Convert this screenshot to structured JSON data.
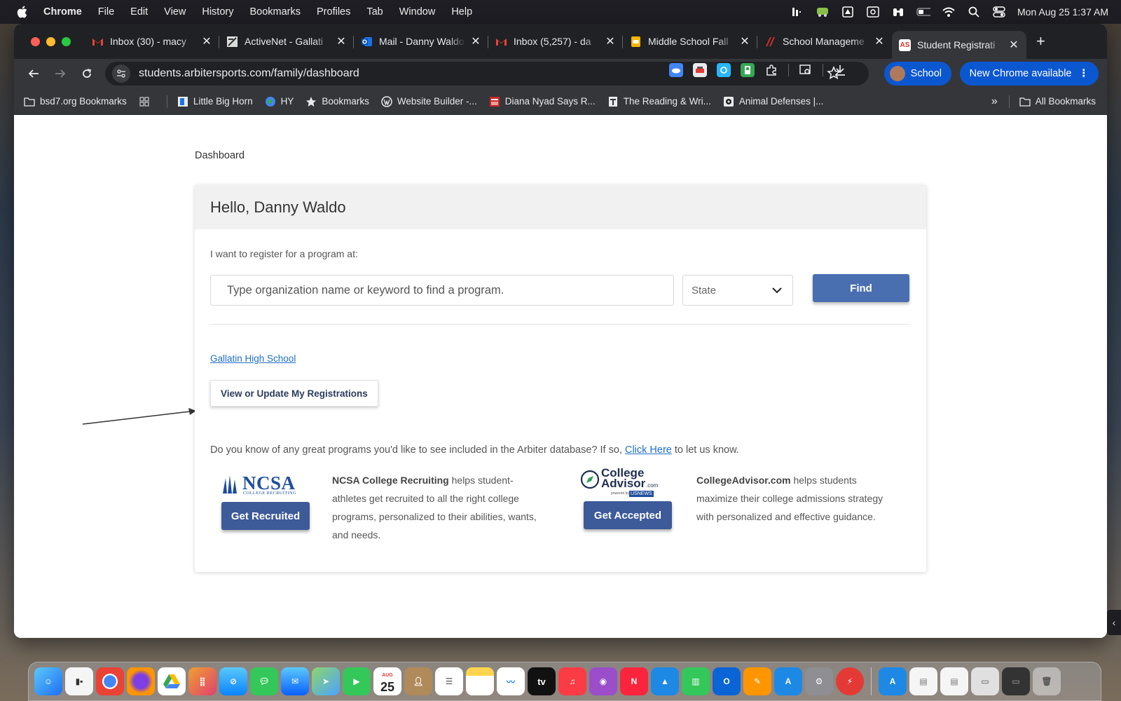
{
  "menubar": {
    "app": "Chrome",
    "items": [
      "File",
      "Edit",
      "View",
      "History",
      "Bookmarks",
      "Profiles",
      "Tab",
      "Window",
      "Help"
    ],
    "clock": "Mon Aug 25  1:37 AM"
  },
  "tabs": [
    {
      "label": "Inbox (30) - macy",
      "favicon": "gmail-icon",
      "color": "#ea4335"
    },
    {
      "label": "ActiveNet - Gallati",
      "favicon": "activenet-icon",
      "color": "#cfcfcf"
    },
    {
      "label": "Mail - Danny Waldo",
      "favicon": "outlook-icon",
      "color": "#1a73e8"
    },
    {
      "label": "Inbox (5,257) - da",
      "favicon": "gmail-icon",
      "color": "#ea4335"
    },
    {
      "label": "Middle School Fall",
      "favicon": "slides-icon",
      "color": "#f4b400"
    },
    {
      "label": "School Manageme",
      "favicon": "arbiter-icon",
      "color": "#d93025"
    },
    {
      "label": "Student Registrati",
      "favicon": "arbiter-as-icon",
      "color": "#ffffff",
      "active": true,
      "fav_text": "AS"
    }
  ],
  "toolbar": {
    "url": "students.arbitersports.com/family/dashboard",
    "profile_label": "School",
    "update_label": "New Chrome available"
  },
  "bookmarks": {
    "items": [
      {
        "label": "bsd7.org Bookmarks",
        "icon": "folder-managed-icon"
      },
      {
        "label": "Little Big Horn",
        "icon": "bookmark-site-icon"
      },
      {
        "label": "HY",
        "icon": "globe-icon"
      },
      {
        "label": "Bookmarks",
        "icon": "star-icon"
      },
      {
        "label": "Website Builder -...",
        "icon": "wordpress-icon"
      },
      {
        "label": "Diana Nyad Says R...",
        "icon": "news-icon"
      },
      {
        "label": "The Reading & Wri...",
        "icon": "page-icon"
      },
      {
        "label": "Animal Defenses |...",
        "icon": "site-icon"
      }
    ],
    "overflow": "»",
    "all_label": "All Bookmarks"
  },
  "page": {
    "breadcrumb": "Dashboard",
    "greeting": "Hello, Danny Waldo",
    "intro": "I want to register for a program at:",
    "search_placeholder": "Type organization name or keyword to find a program.",
    "state_label": "State",
    "find_label": "Find",
    "school_link": "Gallatin High School",
    "view_button": "View or Update My Registrations",
    "know_prefix": "Do you know of any great programs you'd like to see included in the Arbiter database? If so, ",
    "know_link": "Click Here",
    "know_suffix": " to let us know.",
    "ncsa": {
      "logo_text": "NCSA",
      "logo_sub": "COLLEGE RECRUITING",
      "button": "Get Recruited",
      "bold": "NCSA College Recruiting",
      "text": " helps student-athletes get recruited to all the right college programs, personalized to their abilities, wants, and needs."
    },
    "college_advisor": {
      "logo_line1": "College",
      "logo_line2": "Advisor",
      "logo_com": ".com",
      "logo_powered": "powered by",
      "logo_usnews": "USNEWS",
      "button": "Get Accepted",
      "bold": "CollegeAdvisor.com",
      "text": " helps students maximize their college admissions strategy with personalized and effective guidance."
    }
  },
  "dock": {
    "calendar_month": "AUG",
    "calendar_day": "25",
    "tv_label": "tv"
  }
}
